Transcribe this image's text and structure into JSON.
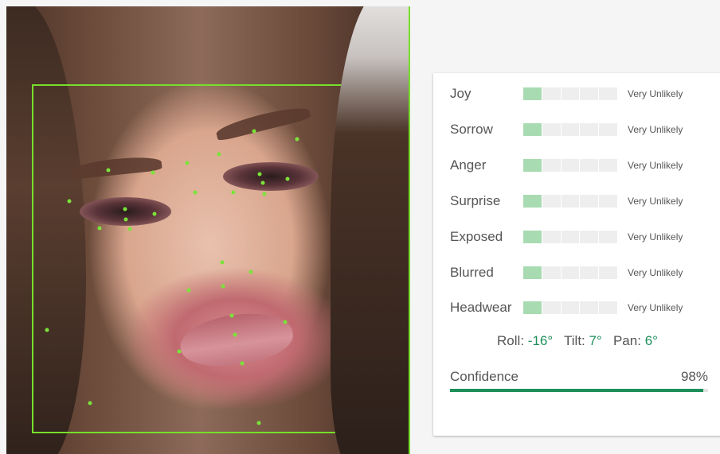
{
  "image": {
    "alt": "face-detection-photo"
  },
  "results": {
    "attributes": [
      {
        "label": "Joy",
        "likelihood": "Very Unlikely",
        "level_fraction": 0.2
      },
      {
        "label": "Sorrow",
        "likelihood": "Very Unlikely",
        "level_fraction": 0.2
      },
      {
        "label": "Anger",
        "likelihood": "Very Unlikely",
        "level_fraction": 0.2
      },
      {
        "label": "Surprise",
        "likelihood": "Very Unlikely",
        "level_fraction": 0.2
      },
      {
        "label": "Exposed",
        "likelihood": "Very Unlikely",
        "level_fraction": 0.2
      },
      {
        "label": "Blurred",
        "likelihood": "Very Unlikely",
        "level_fraction": 0.2
      },
      {
        "label": "Headwear",
        "likelihood": "Very Unlikely",
        "level_fraction": 0.2
      }
    ],
    "angles": {
      "roll_label": "Roll:",
      "roll_value": "-16°",
      "tilt_label": "Tilt:",
      "tilt_value": "7°",
      "pan_label": "Pan:",
      "pan_value": "6°"
    },
    "confidence": {
      "label": "Confidence",
      "value_text": "98%",
      "value_fraction": 0.98
    }
  },
  "colors": {
    "landmark": "#7be33a",
    "bounding_box": "#76e02a",
    "meter_filled": "#a8dbb1",
    "meter_empty": "#eeeeee",
    "accent": "#1e8f5a"
  }
}
